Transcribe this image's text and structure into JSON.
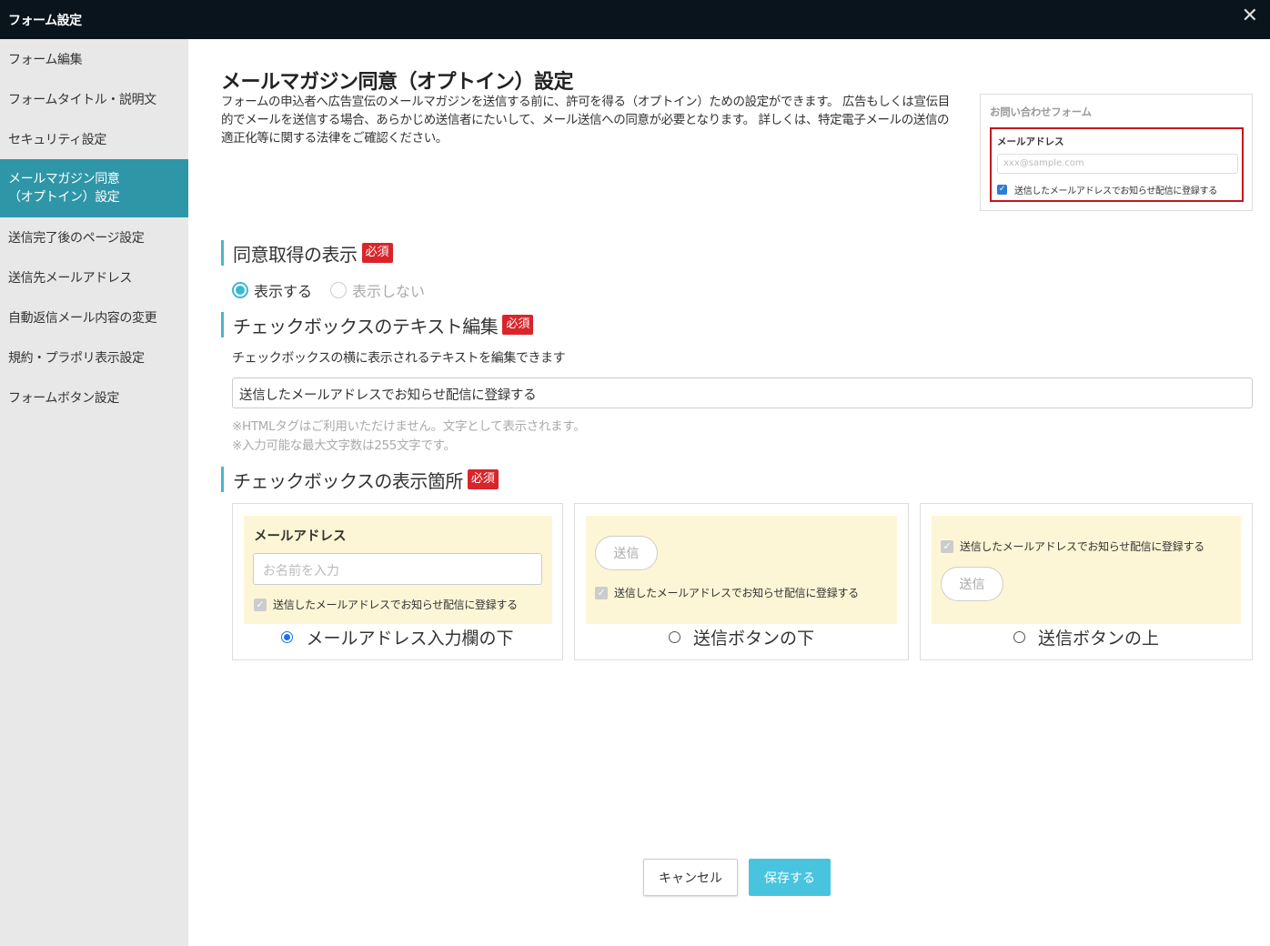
{
  "window": {
    "title": "フォーム設定",
    "close_glyph": "✕"
  },
  "sidebar": {
    "items": [
      {
        "label": "フォーム編集"
      },
      {
        "label": "フォームタイトル・説明文"
      },
      {
        "label": "セキュリティ設定"
      },
      {
        "label": "メールマガジン同意\n（オプトイン）設定",
        "active": true
      },
      {
        "label": "送信完了後のページ設定"
      },
      {
        "label": "送信先メールアドレス"
      },
      {
        "label": "自動返信メール内容の変更"
      },
      {
        "label": "規約・プラポリ表示設定"
      },
      {
        "label": "フォームボタン設定"
      }
    ]
  },
  "page": {
    "title": "メールマガジン同意（オプトイン）設定",
    "description": "フォームの申込者へ広告宣伝のメールマガジンを送信する前に、許可を得る（オプトイン）ための設定ができます。 広告もしくは宣伝目的でメールを送信する場合、あらかじめ送信者にたいして、メール送信への同意が必要となります。 詳しくは、特定電子メールの送信の適正化等に関する法律をご確認ください。"
  },
  "preview": {
    "form_title": "お問い合わせフォーム",
    "email_label": "メールアドレス",
    "email_placeholder": "xxx@sample.com",
    "checkbox_text": "送信したメールアドレスでお知らせ配信に登録する"
  },
  "required_badge": "必須",
  "section_display": {
    "heading": "同意取得の表示",
    "options": [
      {
        "label": "表示する",
        "selected": true
      },
      {
        "label": "表示しない",
        "selected": false
      }
    ]
  },
  "section_text": {
    "heading": "チェックボックスのテキスト編集",
    "description": "チェックボックスの横に表示されるテキストを編集できます",
    "value": "送信したメールアドレスでお知らせ配信に登録する",
    "note1": "※HTMLタグはご利用いただけません。文字として表示されます。",
    "note2": "※入力可能な最大文字数は255文字です。"
  },
  "section_position": {
    "heading": "チェックボックスの表示箇所",
    "card1": {
      "field_label": "メールアドレス",
      "placeholder": "お名前を入力",
      "checkbox_text": "送信したメールアドレスでお知らせ配信に登録する",
      "option": "メールアドレス入力欄の下",
      "selected": true
    },
    "card2": {
      "send_label": "送信",
      "checkbox_text": "送信したメールアドレスでお知らせ配信に登録する",
      "option": "送信ボタンの下",
      "selected": false
    },
    "card3": {
      "send_label": "送信",
      "checkbox_text": "送信したメールアドレスでお知らせ配信に登録する",
      "option": "送信ボタンの上",
      "selected": false
    }
  },
  "footer": {
    "cancel_label": "キャンセル",
    "save_label": "保存する"
  },
  "colors": {
    "topbar": "#09141c",
    "sidebar_active": "#2f96a8",
    "accent": "#48c4df",
    "required": "#d9252a",
    "preview_highlight": "#c5141d"
  }
}
